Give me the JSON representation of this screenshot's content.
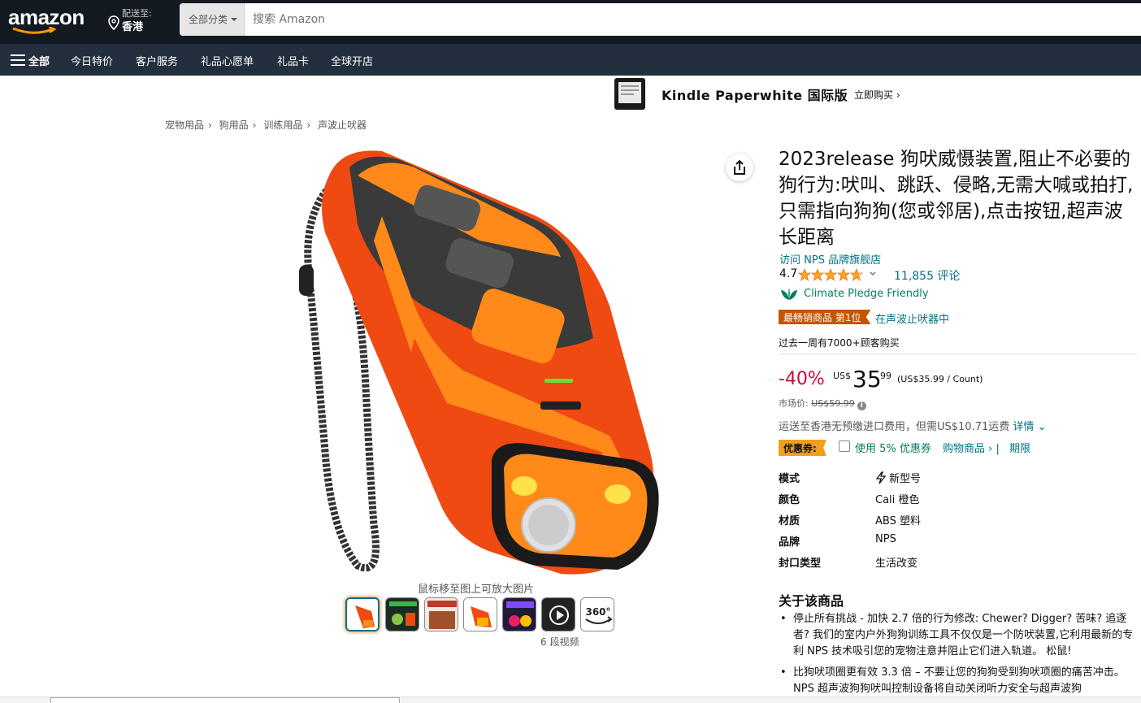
{
  "header": {
    "logo": "amazon",
    "deliver_line1": "配送至:",
    "deliver_line2": "香港",
    "search_category": "全部分类",
    "search_placeholder": "搜索 Amazon"
  },
  "subnav": {
    "all": "全部",
    "items": [
      "今日特价",
      "客户服务",
      "礼品心愿单",
      "礼品卡",
      "全球开店"
    ]
  },
  "kindle": {
    "title": "Kindle Paperwhite 国际版",
    "cta": "立即购买 ›"
  },
  "breadcrumb": [
    "宠物用品",
    "狗用品",
    "训练用品",
    "声波止吠器"
  ],
  "gallery": {
    "zoom_hint": "鼠标移至图上可放大图片",
    "video_label": "6 段视频",
    "view_360_label": "360°"
  },
  "product": {
    "title": "2023release 狗吠威慑装置,阻止不必要的狗行为:吠叫、跳跃、侵略,无需大喊或拍打,只需指向狗狗(您或邻居),点击按钮,超声波长距离",
    "brand_link": "访问 NPS 品牌旗舰店",
    "rating_value": "4.7",
    "rating_stars": 4.7,
    "review_count": "11,855 评论",
    "climate": "Climate Pledge Friendly",
    "best_seller_badge": "最畅销商品 第1位",
    "best_seller_category": "在声波止吠器中",
    "bought": "过去一周有7000+顾客购买",
    "discount": "-40%",
    "price_currency": "US$",
    "price_whole": "35",
    "price_fraction": "99",
    "price_unit": "(US$35.99 / Count)",
    "list_price_label": "市场价: ",
    "list_price": "US$59.99",
    "shipping_text": "运送至香港无预缴进口费用，但需US$10.71运费 ",
    "shipping_link": "详情 ⌄",
    "coupon_badge": "优惠券:",
    "coupon_text": "使用 5% 优惠券",
    "coupon_shop": "购物商品 › |",
    "coupon_terms": "期限"
  },
  "specs": [
    {
      "key": "模式",
      "value": "新型号"
    },
    {
      "key": "颜色",
      "value": "Cali 橙色"
    },
    {
      "key": "材质",
      "value": "ABS 塑料"
    },
    {
      "key": "品牌",
      "value": "NPS"
    },
    {
      "key": "封口类型",
      "value": "生活改变"
    }
  ],
  "about": {
    "title": "关于该商品",
    "bullets": [
      "停止所有挑战 - 加快 2.7 倍的行为修改: Chewer? Digger? 苦味? 追逐者? 我们的室内户外狗狗训练工具不仅仅是一个防吠装置,它利用最新的专利 NPS 技术吸引您的宠物注意并阻止它们进入轨道。 松鼠!",
      "比狗吠项圈更有效 3.3 倍 – 不要让您的狗狗受到狗吠项圈的痛苦冲击。 NPS 超声波狗狗吠叫控制设备将自动关闭听力安全与超声波狗"
    ]
  },
  "colors": {
    "nav_dark": "#131921",
    "nav_sub": "#232f3e",
    "link": "#007185",
    "deal_red": "#cc0c39",
    "badge_orange": "#c45500",
    "coupon_orange": "#f0a01f",
    "star": "#ffa41c",
    "climate_green": "#067d62"
  }
}
